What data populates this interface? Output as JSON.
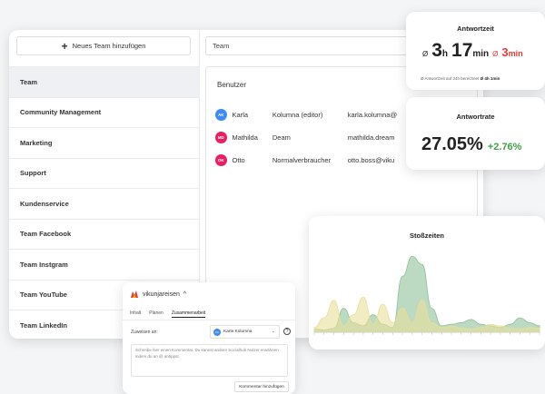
{
  "main": {
    "add_team_label": "Neues Team hinzufügen",
    "search_value": "Team",
    "teams": [
      "Team",
      "Community Management",
      "Marketing",
      "Support",
      "Kundenservice",
      "Team Facebook",
      "Team Instgram",
      "Team YouTube",
      "Team LinkedIn"
    ],
    "users_title": "Benutzer",
    "users": [
      {
        "initials": "AK",
        "name": "Karla",
        "role": "Kolumna (editor)",
        "email": "karla.kolumna@",
        "color": "#3d8bf5"
      },
      {
        "initials": "MD",
        "name": "Mathilda",
        "role": "Deam",
        "email": "mathilda.dream",
        "color": "#e91e63"
      },
      {
        "initials": "OK",
        "name": "Otto",
        "role": "Normalverbraucher",
        "email": "otto.boss@viku",
        "color": "#e91e63"
      }
    ]
  },
  "response_time": {
    "title": "Antwortzeit",
    "avg_symbol": "Ø",
    "hours": "3",
    "hours_unit": "h",
    "minutes": "17",
    "minutes_unit": "min",
    "target_symbol": "Ø",
    "target_minutes": "3",
    "target_unit": "min",
    "note": "Ø Antwortzeit auf 24h berechnet",
    "note_value": "Ø 4h 1min"
  },
  "response_rate": {
    "title": "Antwortrate",
    "value": "27.05%",
    "delta": "+2.76%"
  },
  "chart_data": {
    "type": "area",
    "title": "Stoßzeiten",
    "x": [
      0,
      1,
      2,
      3,
      4,
      5,
      6,
      7,
      8,
      9,
      10,
      11,
      12,
      13,
      14,
      15,
      16,
      17,
      18,
      19,
      20,
      21,
      22,
      23
    ],
    "series": [
      {
        "values": [
          4,
          3,
          5,
          30,
          12,
          8,
          22,
          10,
          6,
          70,
          95,
          85,
          30,
          8,
          10,
          12,
          16,
          10,
          8,
          6,
          10,
          18,
          12,
          8
        ],
        "color": "#8fbf9a"
      },
      {
        "values": [
          6,
          18,
          40,
          8,
          22,
          44,
          10,
          35,
          12,
          30,
          12,
          40,
          12,
          6,
          8,
          5,
          4,
          6,
          10,
          8,
          5,
          4,
          6,
          5
        ],
        "color": "#e8df9a"
      }
    ],
    "grid": false
  },
  "compose": {
    "account": "vikunjareisen",
    "tabs": [
      "Inhalt",
      "Planen",
      "Zusammenarbeit"
    ],
    "assign_label": "Zuweisen an:",
    "assignee": "Karla Kolumna",
    "assignee_initials": "KK",
    "comment_placeholder": "Schreibe hier einen Kommentar. Du kannst andere Socialhub Nutzer erwähnen indem du an @ antippst.",
    "submit_label": "Kommentar hinzufügen"
  }
}
